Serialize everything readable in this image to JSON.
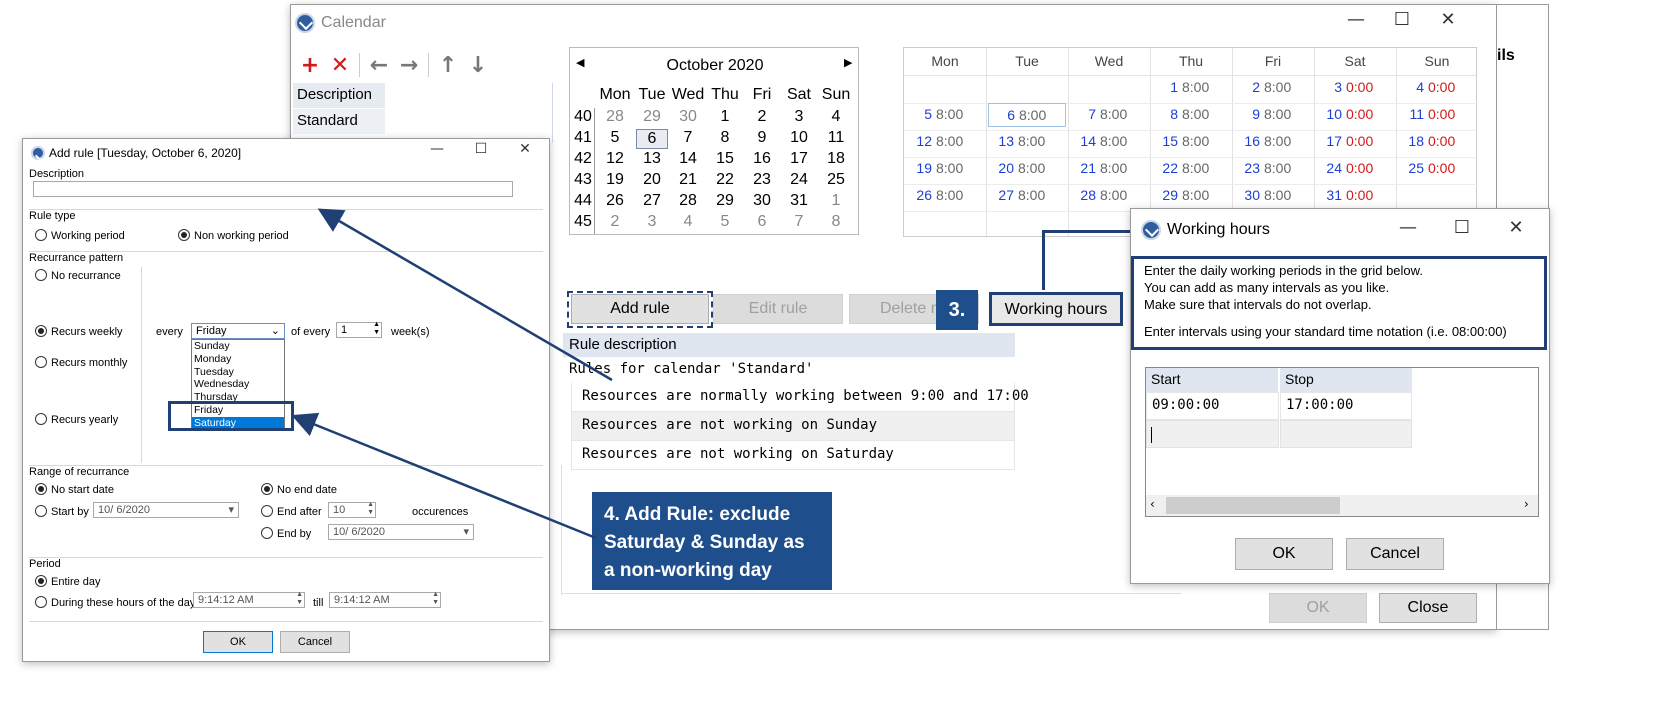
{
  "calendar_window": {
    "title": "Calendar",
    "toolbar": [
      "add-icon",
      "delete-icon",
      "arrow-left-icon",
      "arrow-right-icon",
      "arrow-up-icon",
      "arrow-down-icon"
    ],
    "list_header": "Description",
    "list_item": "Standard",
    "partial_header": "ils"
  },
  "mini_calendar": {
    "month": "October 2020",
    "day_headers": [
      "Mon",
      "Tue",
      "Wed",
      "Thu",
      "Fri",
      "Sat",
      "Sun"
    ],
    "weeks": [
      {
        "wk": "40",
        "days": [
          "28",
          "29",
          "30",
          "1",
          "2",
          "3",
          "4"
        ]
      },
      {
        "wk": "41",
        "days": [
          "5",
          "6",
          "7",
          "8",
          "9",
          "10",
          "11"
        ]
      },
      {
        "wk": "42",
        "days": [
          "12",
          "13",
          "14",
          "15",
          "16",
          "17",
          "18"
        ]
      },
      {
        "wk": "43",
        "days": [
          "19",
          "20",
          "21",
          "22",
          "23",
          "24",
          "25"
        ]
      },
      {
        "wk": "44",
        "days": [
          "26",
          "27",
          "28",
          "29",
          "30",
          "31",
          "1"
        ]
      },
      {
        "wk": "45",
        "days": [
          "2",
          "3",
          "4",
          "5",
          "6",
          "7",
          "8"
        ]
      }
    ]
  },
  "hours_grid": {
    "headers": [
      "Mon",
      "Tue",
      "Wed",
      "Thu",
      "Fri",
      "Sat",
      "Sun"
    ],
    "rows": [
      [
        [
          "",
          ""
        ],
        [
          "",
          ""
        ],
        [
          "",
          ""
        ],
        [
          "1",
          "8:00"
        ],
        [
          "2",
          "8:00"
        ],
        [
          "3",
          "0:00"
        ],
        [
          "4",
          "0:00"
        ]
      ],
      [
        [
          "5",
          "8:00"
        ],
        [
          "6",
          "8:00"
        ],
        [
          "7",
          "8:00"
        ],
        [
          "8",
          "8:00"
        ],
        [
          "9",
          "8:00"
        ],
        [
          "10",
          "0:00"
        ],
        [
          "11",
          "0:00"
        ]
      ],
      [
        [
          "12",
          "8:00"
        ],
        [
          "13",
          "8:00"
        ],
        [
          "14",
          "8:00"
        ],
        [
          "15",
          "8:00"
        ],
        [
          "16",
          "8:00"
        ],
        [
          "17",
          "0:00"
        ],
        [
          "18",
          "0:00"
        ]
      ],
      [
        [
          "19",
          "8:00"
        ],
        [
          "20",
          "8:00"
        ],
        [
          "21",
          "8:00"
        ],
        [
          "22",
          "8:00"
        ],
        [
          "23",
          "8:00"
        ],
        [
          "24",
          "0:00"
        ],
        [
          "25",
          "0:00"
        ]
      ],
      [
        [
          "26",
          "8:00"
        ],
        [
          "27",
          "8:00"
        ],
        [
          "28",
          "8:00"
        ],
        [
          "29",
          "8:00"
        ],
        [
          "30",
          "8:00"
        ],
        [
          "31",
          "0:00"
        ],
        [
          "",
          ""
        ]
      ]
    ]
  },
  "rule_buttons": {
    "add": "Add rule",
    "edit": "Edit rule",
    "delete": "Delete ru",
    "working_hours": "Working hours"
  },
  "rules_table": {
    "header": "Rule description",
    "group": "Rules for calendar 'Standard'",
    "rows": [
      "Resources are normally working between 9:00 and 17:00",
      "Resources are not working on Sunday",
      "Resources are not working on Saturday"
    ]
  },
  "calendar_footer": {
    "ok": "OK",
    "close": "Close"
  },
  "callout3": "3.",
  "callout4": "4. Add Rule: exclude Saturday & Sunday as a non-working day",
  "add_rule_dialog": {
    "title": "Add rule [Tuesday, October 6, 2020]",
    "description_label": "Description",
    "rule_type_label": "Rule type",
    "working_period": "Working period",
    "non_working_period": "Non working period",
    "recurrence_label": "Recurrance pattern",
    "no_recurrence": "No recurrance",
    "recurs_weekly": "Recurs weekly",
    "recurs_monthly": "Recurs monthly",
    "recurs_yearly": "Recurs yearly",
    "every": "every",
    "selected_day": "Friday",
    "of_every": "of every",
    "week_count": "1",
    "weeks_unit": "week(s)",
    "dropdown_options": [
      "Sunday",
      "Monday",
      "Tuesday",
      "Wednesday",
      "Thursday",
      "Friday",
      "Saturday"
    ],
    "range_label": "Range of recurrance",
    "no_start_date": "No start date",
    "start_by": "Start by",
    "start_date": "10/ 6/2020",
    "no_end_date": "No end date",
    "end_after": "End after",
    "occurrences_value": "10",
    "occurrences": "occurences",
    "end_by": "End by",
    "end_date": "10/ 6/2020",
    "period_label": "Period",
    "entire_day": "Entire day",
    "during_hours": "During these hours of the day",
    "from_time": "9:14:12 AM",
    "till": "till",
    "to_time": "9:14:12 AM",
    "ok": "OK",
    "cancel": "Cancel"
  },
  "working_hours_dialog": {
    "title": "Working hours",
    "instructions": [
      "Enter the daily working periods in the grid below.",
      "You can add as many intervals as you like.",
      "Make sure that intervals do not overlap."
    ],
    "instructions_format": "Enter intervals using your standard time notation (i.e. 08:00:00)",
    "col_start": "Start",
    "col_stop": "Stop",
    "start_value": "09:00:00",
    "stop_value": "17:00:00",
    "ok": "OK",
    "cancel": "Cancel"
  },
  "colors": {
    "accent": "#1f4e8c",
    "weekday": "#1c3fd4",
    "weekend": "#d11a1a"
  }
}
